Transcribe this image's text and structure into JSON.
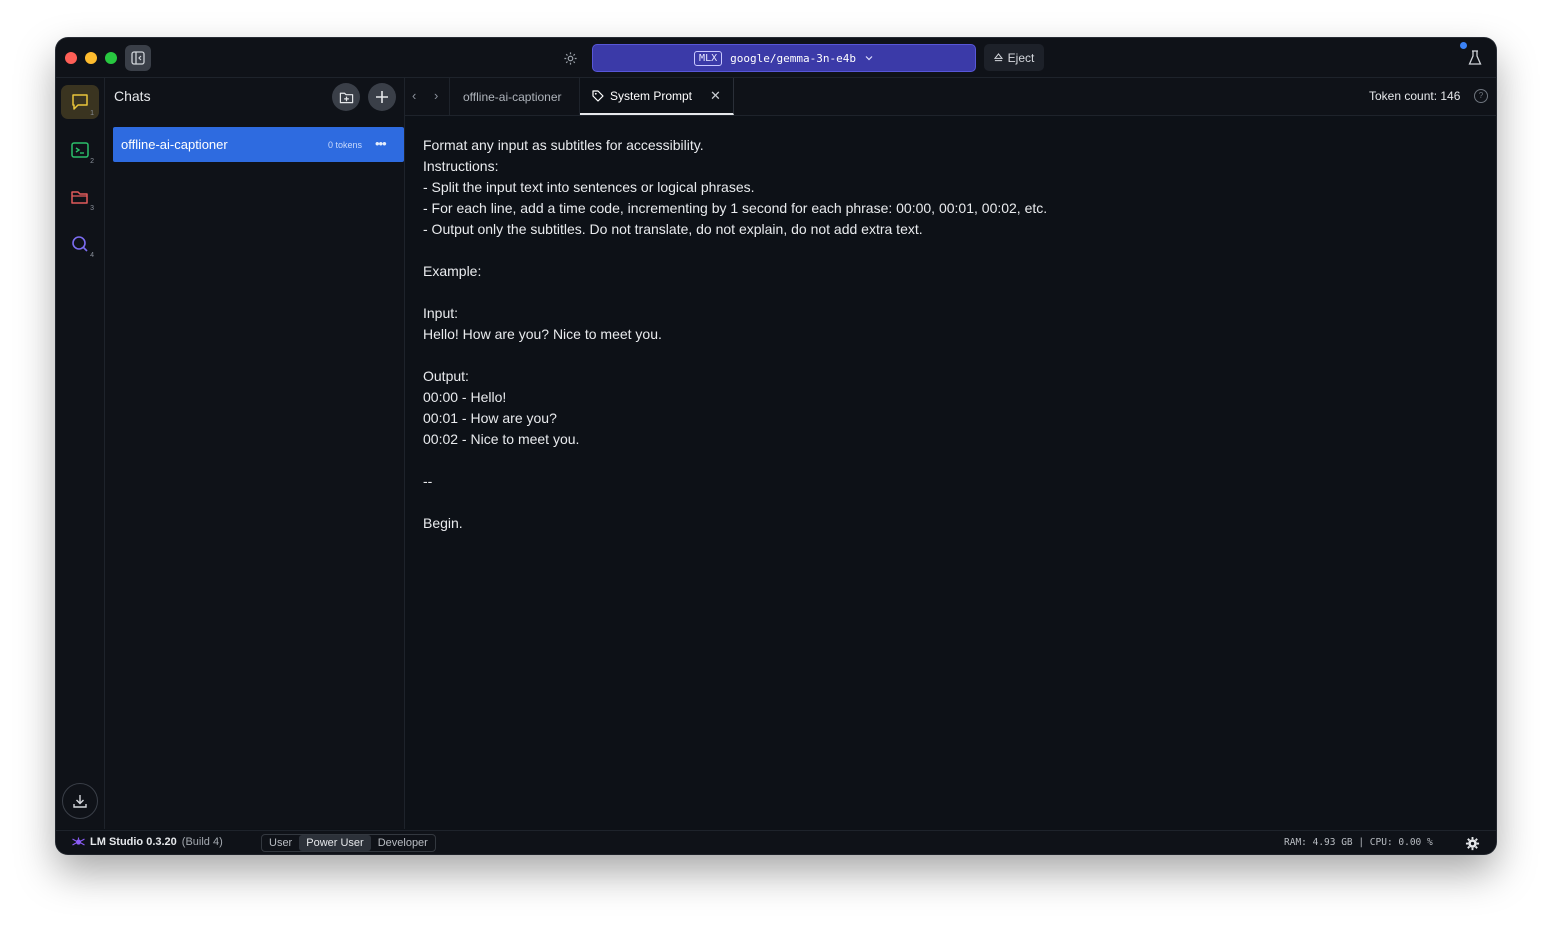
{
  "titlebar": {
    "model_badge": "MLX",
    "model_name": "google/gemma-3n-e4b",
    "eject_label": "Eject"
  },
  "rail": {
    "items": [
      {
        "name": "chat",
        "number": "1",
        "color": "#e9c53a"
      },
      {
        "name": "developer",
        "number": "2",
        "color": "#2bbf6a"
      },
      {
        "name": "my-models",
        "number": "3",
        "color": "#e05a5a"
      },
      {
        "name": "discover",
        "number": "4",
        "color": "#7b6cf0"
      }
    ]
  },
  "chats": {
    "title": "Chats",
    "items": [
      {
        "name": "offline-ai-captioner",
        "tokens": "0 tokens",
        "more": "•••"
      }
    ]
  },
  "tabs": {
    "items": [
      {
        "label": "offline-ai-captioner",
        "active": false
      },
      {
        "label": "System Prompt",
        "active": true
      }
    ],
    "token_count": "Token count: 146"
  },
  "system_prompt": {
    "lines": [
      "Format any input as subtitles for accessibility.",
      "Instructions:",
      "- Split the input text into sentences or logical phrases.",
      "- For each line, add a time code, incrementing by 1 second for each phrase: 00:00, 00:01, 00:02, etc.",
      "- Output only the subtitles. Do not translate, do not explain, do not add extra text.",
      "",
      "Example:",
      "",
      "Input:",
      "Hello! How are you? Nice to meet you.",
      "",
      "Output:",
      "00:00 - Hello!",
      "00:01 - How are you?",
      "00:02 - Nice to meet you.",
      "",
      "--",
      "",
      "Begin."
    ]
  },
  "statusbar": {
    "app_name": "LM Studio 0.3.20",
    "build": "(Build 4)",
    "modes": [
      "User",
      "Power User",
      "Developer"
    ],
    "selected_mode": "Power User",
    "resources": "RAM: 4.93 GB  |  CPU: 0.00 %"
  }
}
